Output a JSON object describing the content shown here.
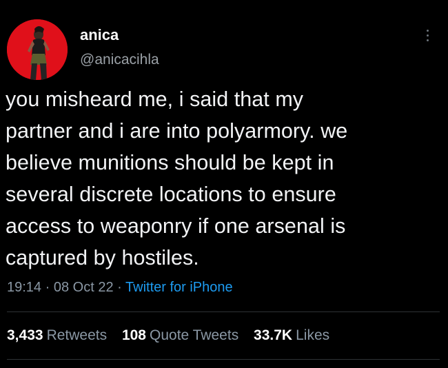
{
  "user": {
    "display_name": "anica",
    "handle": "@anicacihla",
    "avatar_icon": "profile-photo-avatar",
    "avatar_bg": "#e0101a"
  },
  "tweet": {
    "text": "you misheard me, i said that my\npartner and i are into polyarmory. we\nbelieve munitions should be kept in\nseveral discrete locations to ensure\naccess to weaponry if one arsenal is\ncaptured by hostiles.",
    "time": "19:14",
    "date": "08 Oct 22",
    "separator": "·",
    "source": "Twitter for iPhone"
  },
  "stats": {
    "retweets_count": "3,433",
    "retweets_label": "Retweets",
    "quotes_count": "108",
    "quotes_label": "Quote Tweets",
    "likes_count": "33.7K",
    "likes_label": "Likes"
  },
  "colors": {
    "background": "#000000",
    "link": "#1d9bf0",
    "secondary_text": "#8b98a5"
  },
  "icons": {
    "more_menu": "more-vertical-icon"
  }
}
